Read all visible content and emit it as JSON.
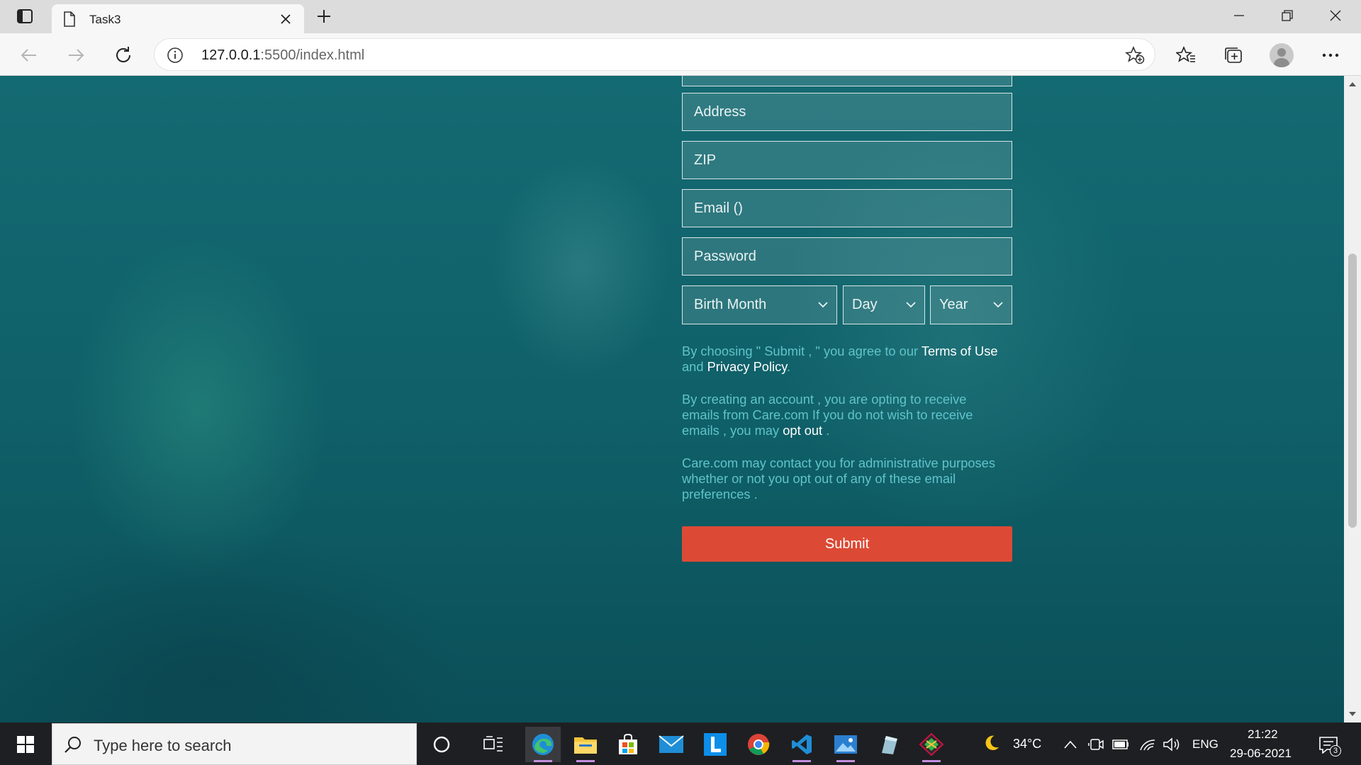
{
  "browser": {
    "tab_title": "Task3",
    "url_host": "127.0.0.1",
    "url_rest": ":5500/index.html"
  },
  "form": {
    "fields": [
      {
        "placeholder": "Address"
      },
      {
        "placeholder": "ZIP"
      },
      {
        "placeholder": "Email ()"
      },
      {
        "placeholder": "Password"
      }
    ],
    "selects": {
      "month": "Birth Month",
      "day": "Day",
      "year": "Year"
    },
    "terms": {
      "text1": "By choosing \" Submit , \" you agree to our ",
      "terms_link": "Terms of Use",
      "text2": "and ",
      "privacy_link": "Privacy Policy",
      "text3": "."
    },
    "optin": {
      "line1": "By creating an account , you are opting to receive",
      "line2": "emails from Care.com If you do not wish to receive",
      "line3": "emails , you may ",
      "opt_out_link": "opt out",
      "line3_end": " ."
    },
    "admin": {
      "line1": "Care.com may contact you for administrative purposes",
      "line2": "whether or not you opt out of any of these email",
      "line3": "preferences ."
    },
    "submit_label": "Submit"
  },
  "taskbar": {
    "search_placeholder": "Type here to search",
    "weather": "34°C",
    "language": "ENG",
    "time": "21:22",
    "date": "29-06-2021",
    "notification_count": "3"
  },
  "colors": {
    "submit": "#dc4a35",
    "paragraph": "#5fc4c9",
    "page_bg": "#0e5a63"
  }
}
